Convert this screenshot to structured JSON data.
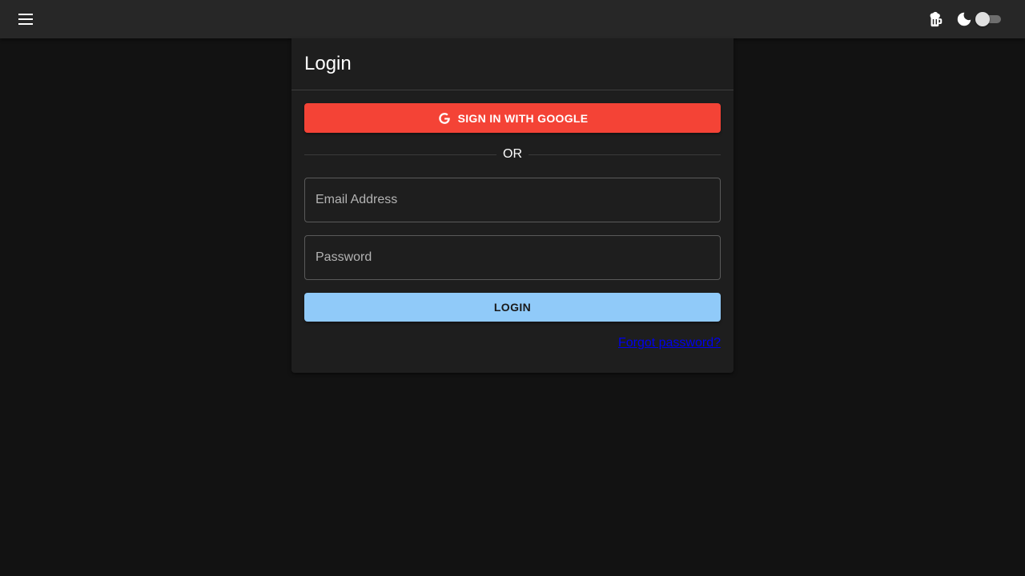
{
  "header": {
    "menu_icon": "menu-icon",
    "donate_icon": "beer-icon",
    "theme_icon": "moon-icon",
    "dark_mode_toggle": "off"
  },
  "login": {
    "title": "Login",
    "google_button_label": "SIGN IN WITH GOOGLE",
    "google_icon": "google-icon",
    "divider_text": "OR",
    "email_placeholder": "Email Address",
    "email_value": "",
    "password_placeholder": "Password",
    "password_value": "",
    "login_button_label": "LOGIN",
    "forgot_password_link": "Forgot password?"
  },
  "colors": {
    "background": "#121212",
    "appbar": "#272727",
    "card": "#1e1e1e",
    "google_button": "#f44336",
    "login_button": "#90caf9",
    "link": "#0000ee"
  }
}
